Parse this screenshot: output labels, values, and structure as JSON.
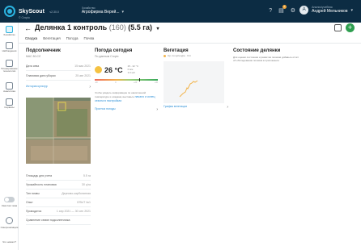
{
  "topbar": {
    "app_name": "SkyScout",
    "version": "v2.30.0",
    "by": "© Cropio",
    "org_label": "Хозяйство",
    "org_name": "Агрофирма Верей...",
    "org_chevron": "▾",
    "user_role": "Анализ/учебник",
    "user_name": "Андрей Мельников",
    "user_initial": "A",
    "notification_count": "1",
    "icons": [
      "help-icon",
      "notifications-icon",
      "settings-icon"
    ]
  },
  "sidebar": {
    "items": [
      {
        "label": "Хозяйство",
        "icon": "farm-icon",
        "active": true
      },
      {
        "label": "Наблюдения",
        "icon": "observations-icon",
        "active": false
      },
      {
        "label": "Планирование технологии",
        "icon": "planning-icon",
        "active": false
      },
      {
        "label": "Аналитика",
        "icon": "analytics-icon",
        "active": false
      },
      {
        "label": "Сервисы",
        "icon": "services-icon",
        "active": false
      }
    ],
    "toggle_label": "Светлая тема",
    "sync_label": "Синхронизация",
    "help_label": "Что нового?"
  },
  "header": {
    "back": "←",
    "title": "Делянка 1 контроль",
    "count": "(160)",
    "area": "(5.5 га)",
    "title_chevron": "▾",
    "add": "+"
  },
  "tabs": [
    "Сводка",
    "Вегетация",
    "Погода",
    "Почва"
  ],
  "field_card": {
    "title": "Подсолнечник",
    "subtitle": "МАС 80.СЛ",
    "rows": [
      {
        "label": "Дата сева",
        "value": "15 мая 2021"
      },
      {
        "label": "Плановая дата уборки",
        "value": "25 авг 2021"
      }
    ],
    "history_link": "История культур",
    "details": [
      {
        "label": "Площадь для учета",
        "value": "5.5 га"
      },
      {
        "label": "Урожайность плановая",
        "value": "30 ц/га"
      },
      {
        "label": "Тип почвы",
        "value": "Дерново-карбонатная"
      },
      {
        "label": "Опыт",
        "value": "ОПЫТ №1"
      },
      {
        "label": "Проводится",
        "value": "1 апр 2021 — 30 сен 2021"
      },
      {
        "label": "Сравнение семян подсолнечника",
        "value": ""
      }
    ]
  },
  "weather_card": {
    "title": "Погода сегодня",
    "subtitle": "По данным Cropio",
    "icon": "sun-icon",
    "temperature": "26 °C",
    "meta": [
      "25...32 °C",
      "0 мм",
      "3.0 м/с"
    ],
    "scale": [
      "-20",
      "0",
      "+20",
      "+40"
    ],
    "temperature_position": 0.7,
    "note_text": "Чтобы увидеть информацию по накопленной температуре и осадкам, выставьте ",
    "note_link": "начало и конец сезона в настройках",
    "forecast_link": "Прогноз погоды"
  },
  "vegetation_card": {
    "title": "Вегетация",
    "legend": "Ср. по культуре · 0.4",
    "link": "График вегетации",
    "line_color": "#f2b44c"
  },
  "condition_card": {
    "title": "Состояние делянки",
    "text": "Для оценки состояния и развития посевов добавьте отчёт об обследовании посевов в приложении."
  }
}
